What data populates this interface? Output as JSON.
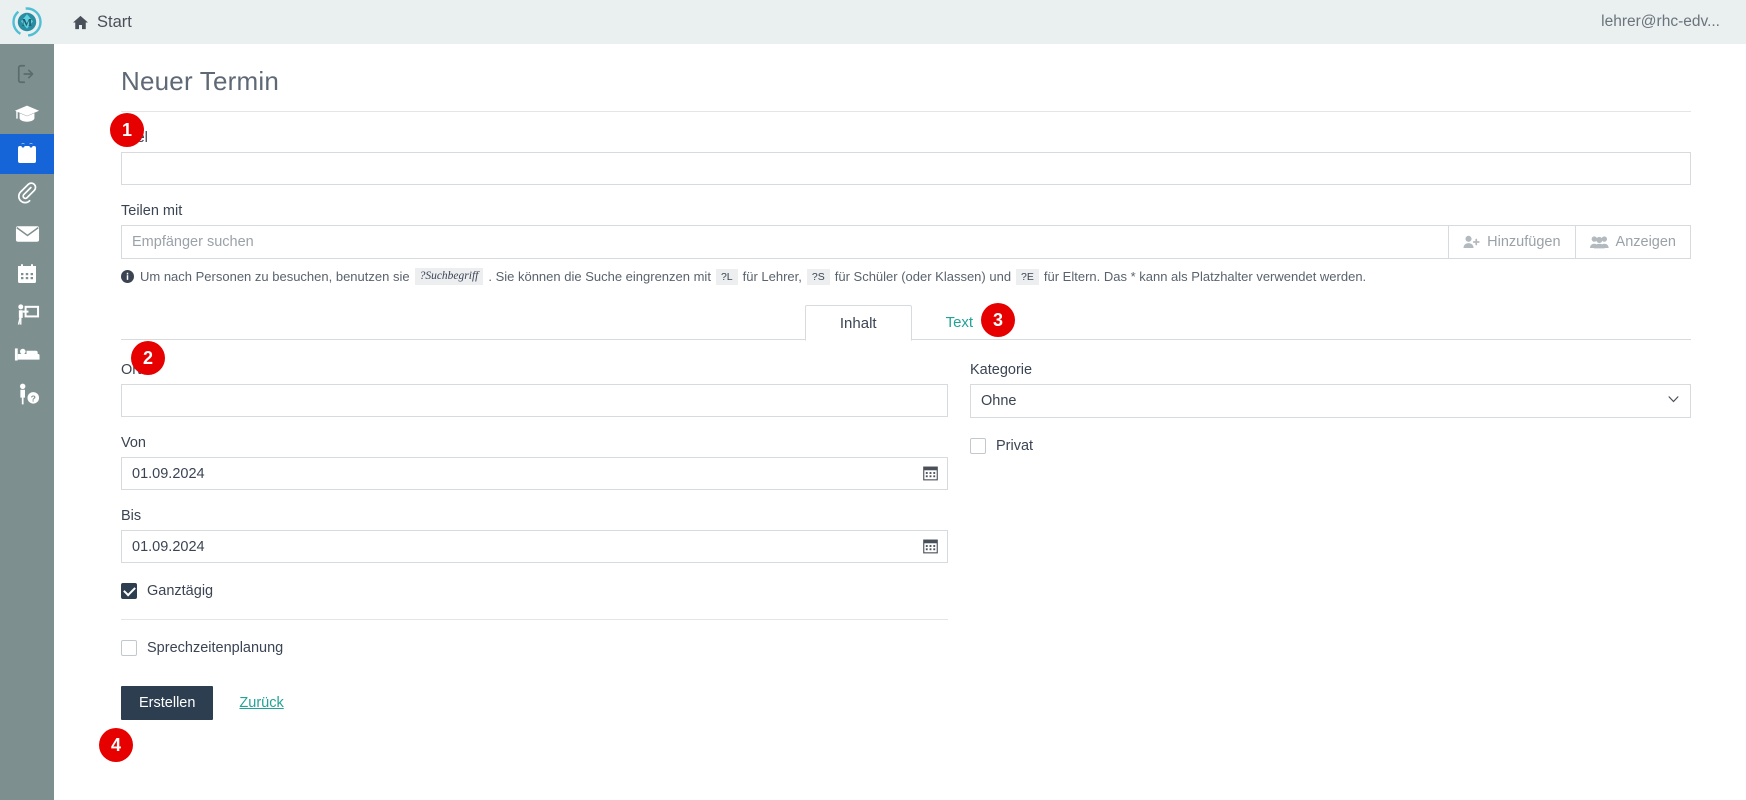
{
  "topbar": {
    "logo_name": "mebis-logo",
    "start_label": "Start",
    "user_label": "lehrer@rhc-edv..."
  },
  "sidebar": {
    "items": [
      {
        "name": "logout-icon",
        "label": "Abmelden"
      },
      {
        "name": "graduation-cap-icon",
        "label": "Unterricht"
      },
      {
        "name": "calendar-icon",
        "label": "Termine",
        "active": true
      },
      {
        "name": "paperclip-icon",
        "label": "Dateien"
      },
      {
        "name": "envelope-icon",
        "label": "Nachrichten"
      },
      {
        "name": "calendar-grid-icon",
        "label": "Kalender"
      },
      {
        "name": "presentation-icon",
        "label": "Unterrichtsplanung"
      },
      {
        "name": "bed-icon",
        "label": "Krankmeldung"
      },
      {
        "name": "person-help-icon",
        "label": "Hilfe"
      }
    ]
  },
  "page": {
    "title": "Neuer Termin"
  },
  "titel_field": {
    "label": "Titel",
    "value": "",
    "placeholder": ""
  },
  "share": {
    "label": "Teilen mit",
    "placeholder": "Empfänger suchen",
    "value": "",
    "add_button": "Hinzufügen",
    "show_button": "Anzeigen",
    "hint": {
      "icon": "info-icon",
      "part1": "Um nach Personen zu besuchen, benutzen sie",
      "code1": "?Suchbegriff",
      "part2": ". Sie können die Suche eingrenzen mit",
      "code2": "?L",
      "part3": "für Lehrer,",
      "code3": "?S",
      "part4": "für Schüler (oder Klassen) und",
      "code4": "?E",
      "part5": "für Eltern. Das * kann als Platzhalter verwendet werden."
    }
  },
  "tabs": [
    {
      "label": "Inhalt",
      "active": true
    },
    {
      "label": "Text",
      "active": false
    }
  ],
  "form": {
    "ort": {
      "label": "Ort",
      "value": "",
      "placeholder": ""
    },
    "von": {
      "label": "Von",
      "value": "01.09.2024",
      "icon": "calendar-picker-icon"
    },
    "bis": {
      "label": "Bis",
      "value": "01.09.2024",
      "icon": "calendar-picker-icon"
    },
    "ganztaegig": {
      "label": "Ganztägig",
      "checked": true
    },
    "sprechzeiten": {
      "label": "Sprechzeitenplanung",
      "checked": false
    },
    "kategorie": {
      "label": "Kategorie",
      "value": "Ohne",
      "options": [
        "Ohne"
      ]
    },
    "privat": {
      "label": "Privat",
      "checked": false
    }
  },
  "actions": {
    "submit_label": "Erstellen",
    "back_label": "Zurück"
  },
  "badges": [
    {
      "id": "badge1",
      "text": "1"
    },
    {
      "id": "badge2",
      "text": "2"
    },
    {
      "id": "badge3",
      "text": "3"
    },
    {
      "id": "badge4",
      "text": "4"
    }
  ],
  "colors": {
    "accent_teal": "#23a396",
    "sidebar": "#7e8f8f",
    "sidebar_active": "#1565d8",
    "topbar": "#eaeff0",
    "primary_button": "#2c3e50",
    "badge_red": "#e60000"
  }
}
